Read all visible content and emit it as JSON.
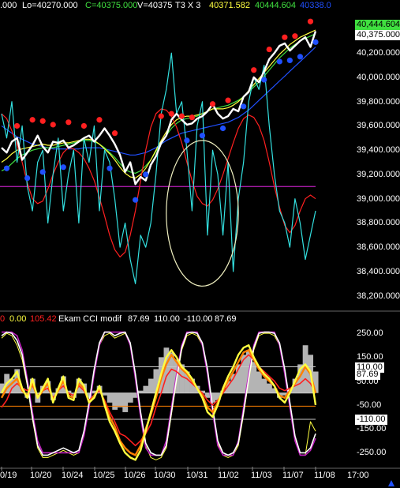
{
  "header": {
    "open_tail": ".000",
    "low": "Lo=40270.000",
    "close": "C=40375.000",
    "volume": "V=40375",
    "bars": "T3 X 3",
    "v1": "40371.582",
    "v2": "40444.604",
    "v3": "40338.0"
  },
  "badges": {
    "green": "40,444.604",
    "white": "40,375.000"
  },
  "cci_header": {
    "a": "0",
    "b": "0.00",
    "c": "105.42",
    "title": "Ekam CCI modif",
    "d": "87.69",
    "e": "110.00",
    "f": "-110.00",
    "g": "87.69"
  },
  "cci_badges": {
    "upper": "110.00",
    "value": "87.69",
    "lower": "-110.00"
  },
  "colors": {
    "price": "#ffffff",
    "cyan": "#33e0e0",
    "red": "#ff2020",
    "green": "#40e040",
    "yellow": "#ffff40",
    "blue": "#2050ff",
    "magenta": "#c020c0",
    "orange": "#ff8000"
  },
  "chart_data": [
    {
      "type": "line",
      "title": "",
      "y_ticks": [
        "40,200.000",
        "40,000.000",
        "39,800.000",
        "39,600.000",
        "39,400.000",
        "39,200.000",
        "39,000.000",
        "38,800.000",
        "38,600.000",
        "38,400.000",
        "38,200.000"
      ],
      "ylim": [
        38100,
        40520
      ],
      "horizontal_line": 39100,
      "series": [
        {
          "key": "price",
          "color": "#ffffff",
          "values": [
            39420,
            39380,
            39470,
            39500,
            39320,
            39380,
            39440,
            39520,
            39430,
            39380,
            39470,
            39460,
            39480,
            39420,
            39440,
            39470,
            39500,
            39520,
            39470,
            39520,
            39580,
            39520,
            39450,
            39360,
            39220,
            39300,
            39120,
            39180,
            39150,
            39280,
            39350,
            39460,
            39520,
            39650,
            39700,
            39650,
            39610,
            39620,
            39660,
            39680,
            39720,
            39780,
            39700,
            39660,
            39680,
            39740,
            39720,
            39840,
            39880,
            40000,
            39960,
            40050,
            40150,
            40200,
            40260,
            40280,
            40220,
            40260,
            40300,
            40330,
            40250,
            40380
          ]
        },
        {
          "key": "cyan",
          "color": "#33e0e0",
          "values": [
            39700,
            39500,
            39800,
            39300,
            39600,
            39100,
            38900,
            39300,
            39400,
            38800,
            39200,
            39500,
            38900,
            39200,
            39400,
            38800,
            39500,
            39300,
            39600,
            38900,
            39400,
            39300,
            39000,
            38600,
            38800,
            38500,
            38300,
            38700,
            38600,
            38800,
            39200,
            39700,
            39900,
            40200,
            39700,
            39800,
            39400,
            38900,
            39600,
            39800,
            38700,
            39400,
            39200,
            38700,
            39300,
            38400,
            39000,
            39300,
            39800,
            40000,
            39900,
            40100,
            39600,
            39200,
            38900,
            38800,
            38600,
            39000,
            38800,
            38500,
            38700,
            38900
          ]
        },
        {
          "key": "red",
          "color": "#ff2020",
          "values": [
            39700,
            39660,
            39560,
            39440,
            39300,
            39130,
            39000,
            38960,
            38980,
            39080,
            39200,
            39300,
            39380,
            39420,
            39410,
            39380,
            39330,
            39250,
            39150,
            39010,
            38860,
            38700,
            38580,
            38520,
            38560,
            38700,
            38900,
            39150,
            39400,
            39590,
            39700,
            39740,
            39730,
            39680,
            39590,
            39460,
            39300,
            39150,
            39020,
            38960,
            38940,
            38990,
            39080,
            39200,
            39330,
            39460,
            39580,
            39660,
            39690,
            39670,
            39600,
            39480,
            39300,
            39100,
            38930,
            38780,
            38720,
            38780,
            38900,
            39000,
            39030,
            39000
          ]
        },
        {
          "key": "green",
          "color": "#40e040",
          "values": [
            39230,
            39250,
            39290,
            39330,
            39360,
            39380,
            39400,
            39410,
            39420,
            39420,
            39420,
            39430,
            39440,
            39450,
            39460,
            39470,
            39480,
            39480,
            39470,
            39450,
            39420,
            39380,
            39340,
            39290,
            39240,
            39220,
            39210,
            39230,
            39270,
            39320,
            39390,
            39450,
            39520,
            39580,
            39620,
            39650,
            39660,
            39670,
            39680,
            39700,
            39720,
            39740,
            39750,
            39760,
            39770,
            39790,
            39810,
            39840,
            39880,
            39920,
            39960,
            40010,
            40060,
            40110,
            40160,
            40200,
            40240,
            40270,
            40300,
            40320,
            40340,
            40360
          ]
        },
        {
          "key": "yellow",
          "color": "#ffff40",
          "values": [
            39300,
            39330,
            39370,
            39400,
            39410,
            39420,
            39430,
            39440,
            39450,
            39440,
            39440,
            39450,
            39460,
            39460,
            39470,
            39480,
            39490,
            39490,
            39480,
            39450,
            39410,
            39370,
            39320,
            39260,
            39210,
            39180,
            39170,
            39200,
            39250,
            39320,
            39400,
            39480,
            39550,
            39610,
            39650,
            39670,
            39680,
            39680,
            39690,
            39700,
            39720,
            39740,
            39740,
            39740,
            39750,
            39770,
            39800,
            39840,
            39890,
            39940,
            39990,
            40040,
            40090,
            40140,
            40190,
            40230,
            40270,
            40300,
            40330,
            40350,
            40370,
            40390
          ]
        },
        {
          "key": "blue",
          "color": "#2050ff",
          "values": [
            39600,
            39570,
            39540,
            39510,
            39490,
            39470,
            39450,
            39440,
            39430,
            39420,
            39410,
            39410,
            39410,
            39410,
            39410,
            39410,
            39420,
            39420,
            39420,
            39420,
            39410,
            39400,
            39390,
            39380,
            39370,
            39360,
            39360,
            39370,
            39380,
            39400,
            39420,
            39450,
            39480,
            39500,
            39520,
            39540,
            39550,
            39560,
            39570,
            39580,
            39590,
            39600,
            39610,
            39620,
            39630,
            39650,
            39670,
            39700,
            39730,
            39770,
            39810,
            39850,
            39890,
            39930,
            39970,
            40010,
            40050,
            40090,
            40130,
            40170,
            40210,
            40250
          ]
        }
      ],
      "signals_red": [
        [
          3,
          39600
        ],
        [
          6,
          39650
        ],
        [
          8,
          39640
        ],
        [
          10,
          39610
        ],
        [
          13,
          39630
        ],
        [
          16,
          39600
        ],
        [
          19,
          39650
        ],
        [
          22,
          39540
        ],
        [
          31,
          39680
        ],
        [
          33,
          39700
        ],
        [
          35,
          39680
        ],
        [
          37,
          39670
        ],
        [
          41,
          39780
        ],
        [
          44,
          39810
        ],
        [
          49,
          40060
        ],
        [
          52,
          40230
        ],
        [
          55,
          40330
        ],
        [
          57,
          40340
        ],
        [
          60,
          40460
        ]
      ],
      "signals_blue": [
        [
          1,
          39250
        ],
        [
          5,
          39170
        ],
        [
          8,
          39220
        ],
        [
          12,
          39260
        ],
        [
          21,
          39250
        ],
        [
          26,
          38990
        ],
        [
          28,
          39200
        ],
        [
          36,
          39480
        ],
        [
          39,
          39520
        ],
        [
          43,
          39580
        ],
        [
          47,
          39760
        ],
        [
          51,
          39980
        ],
        [
          54,
          40130
        ],
        [
          56,
          40140
        ],
        [
          58,
          40170
        ],
        [
          61,
          40290
        ]
      ],
      "ellipse": {
        "cx": 39,
        "cy": 38880,
        "rx": 7,
        "ry": 600
      }
    },
    {
      "type": "line",
      "title": "Ekam CCI modif",
      "y_ticks": [
        "250.00",
        "150.00",
        "50.00",
        "-50.00",
        "-150.00",
        "-250.00"
      ],
      "ylim": [
        -305,
        290
      ],
      "h_lines": [
        {
          "value": 110,
          "color": "#c8c8c8"
        },
        {
          "value": 0,
          "color": "#c8c8c8"
        },
        {
          "value": -110,
          "color": "#c8c8c8"
        },
        {
          "value": -55,
          "color": "#ff8000"
        }
      ],
      "series": [
        {
          "key": "hist",
          "color": "#b4b4b4",
          "type": "area",
          "values": [
            40,
            80,
            60,
            100,
            20,
            -20,
            60,
            -40,
            30,
            50,
            -30,
            20,
            70,
            10,
            -20,
            60,
            40,
            -20,
            10,
            30,
            -10,
            -40,
            -70,
            -60,
            -80,
            -40,
            -20,
            10,
            30,
            60,
            100,
            150,
            190,
            170,
            140,
            120,
            90,
            60,
            30,
            10,
            -20,
            -40,
            -30,
            10,
            50,
            80,
            120,
            160,
            180,
            130,
            90,
            60,
            40,
            20,
            -20,
            -10,
            20,
            60,
            120,
            200,
            160,
            90
          ]
        },
        {
          "key": "red",
          "color": "#ff2020",
          "values": [
            -60,
            -30,
            20,
            40,
            20,
            10,
            30,
            -10,
            10,
            20,
            -20,
            10,
            30,
            0,
            -10,
            30,
            10,
            -30,
            -10,
            10,
            -30,
            -80,
            -120,
            -170,
            -180,
            -200,
            -220,
            -200,
            -170,
            -130,
            -60,
            0,
            70,
            100,
            90,
            70,
            60,
            40,
            20,
            0,
            -30,
            -50,
            -30,
            0,
            30,
            60,
            100,
            140,
            160,
            140,
            110,
            90,
            70,
            50,
            20,
            10,
            20,
            30,
            40,
            60,
            40,
            0
          ]
        },
        {
          "key": "orange",
          "color": "#ff8000",
          "values": [
            -20,
            20,
            40,
            60,
            10,
            -10,
            40,
            -20,
            10,
            40,
            -30,
            10,
            50,
            -10,
            -20,
            40,
            20,
            -40,
            -10,
            20,
            -40,
            -100,
            -140,
            -200,
            -230,
            -250,
            -260,
            -220,
            -150,
            -90,
            -20,
            60,
            120,
            160,
            130,
            100,
            80,
            50,
            20,
            -10,
            -60,
            -80,
            -40,
            10,
            50,
            90,
            130,
            170,
            180,
            140,
            100,
            70,
            50,
            30,
            -10,
            -20,
            10,
            40,
            70,
            110,
            80,
            0
          ]
        },
        {
          "key": "yellow",
          "color": "#ffff40",
          "values": [
            0,
            40,
            60,
            90,
            20,
            -20,
            60,
            -20,
            20,
            60,
            -40,
            20,
            70,
            -20,
            -30,
            60,
            30,
            -40,
            -20,
            30,
            -50,
            -120,
            -160,
            -210,
            -250,
            -270,
            -280,
            -240,
            -160,
            -80,
            0,
            80,
            150,
            180,
            150,
            110,
            90,
            60,
            20,
            -20,
            -80,
            -100,
            -50,
            20,
            70,
            110,
            160,
            190,
            200,
            150,
            110,
            80,
            60,
            30,
            -20,
            -40,
            0,
            50,
            100,
            120,
            90,
            -50
          ]
        },
        {
          "key": "magenta",
          "color": "#c020c0",
          "values": [
            255,
            255,
            255,
            240,
            180,
            60,
            -80,
            -200,
            -250,
            -250,
            -250,
            -250,
            -250,
            -250,
            -250,
            -250,
            -180,
            -60,
            80,
            200,
            255,
            255,
            255,
            255,
            255,
            200,
            60,
            -100,
            -230,
            -260,
            -260,
            -260,
            -200,
            -60,
            80,
            200,
            255,
            255,
            255,
            200,
            80,
            -80,
            -220,
            -260,
            -260,
            -260,
            -200,
            -60,
            80,
            200,
            255,
            255,
            255,
            255,
            200,
            80,
            -60,
            -200,
            -260,
            -260,
            -240,
            -190
          ]
        },
        {
          "key": "white",
          "color": "#ffffff",
          "values": [
            240,
            255,
            250,
            220,
            160,
            40,
            -100,
            -220,
            -260,
            -260,
            -250,
            -240,
            -230,
            -240,
            -250,
            -240,
            -160,
            -40,
            100,
            210,
            255,
            255,
            240,
            250,
            255,
            210,
            80,
            -80,
            -210,
            -250,
            -260,
            -260,
            -220,
            -80,
            60,
            190,
            250,
            255,
            250,
            210,
            100,
            -60,
            -200,
            -250,
            -260,
            -250,
            -210,
            -80,
            60,
            190,
            250,
            255,
            255,
            250,
            210,
            100,
            -40,
            -180,
            -250,
            -250,
            -230,
            -170
          ]
        },
        {
          "key": "thin_yellow",
          "color": "#ffff40",
          "values": [
            230,
            250,
            240,
            200,
            140,
            30,
            -110,
            -230,
            -270,
            -270,
            -260,
            -250,
            -240,
            -250,
            -260,
            -250,
            -170,
            -50,
            90,
            200,
            240,
            250,
            230,
            240,
            250,
            200,
            70,
            -90,
            -220,
            -270,
            -280,
            -270,
            -230,
            -90,
            50,
            180,
            240,
            250,
            240,
            200,
            90,
            -70,
            -210,
            -260,
            -270,
            -260,
            -220,
            -90,
            50,
            180,
            240,
            250,
            250,
            240,
            200,
            90,
            -50,
            -190,
            -260,
            -260,
            -120,
            -160
          ]
        }
      ]
    }
  ],
  "x_labels": [
    "0/19",
    "10/20",
    "10/24",
    "10/25",
    "10/26",
    "10/30",
    "10/31",
    "11/02",
    "11/03",
    "11/07",
    "11/08",
    "17:00"
  ]
}
